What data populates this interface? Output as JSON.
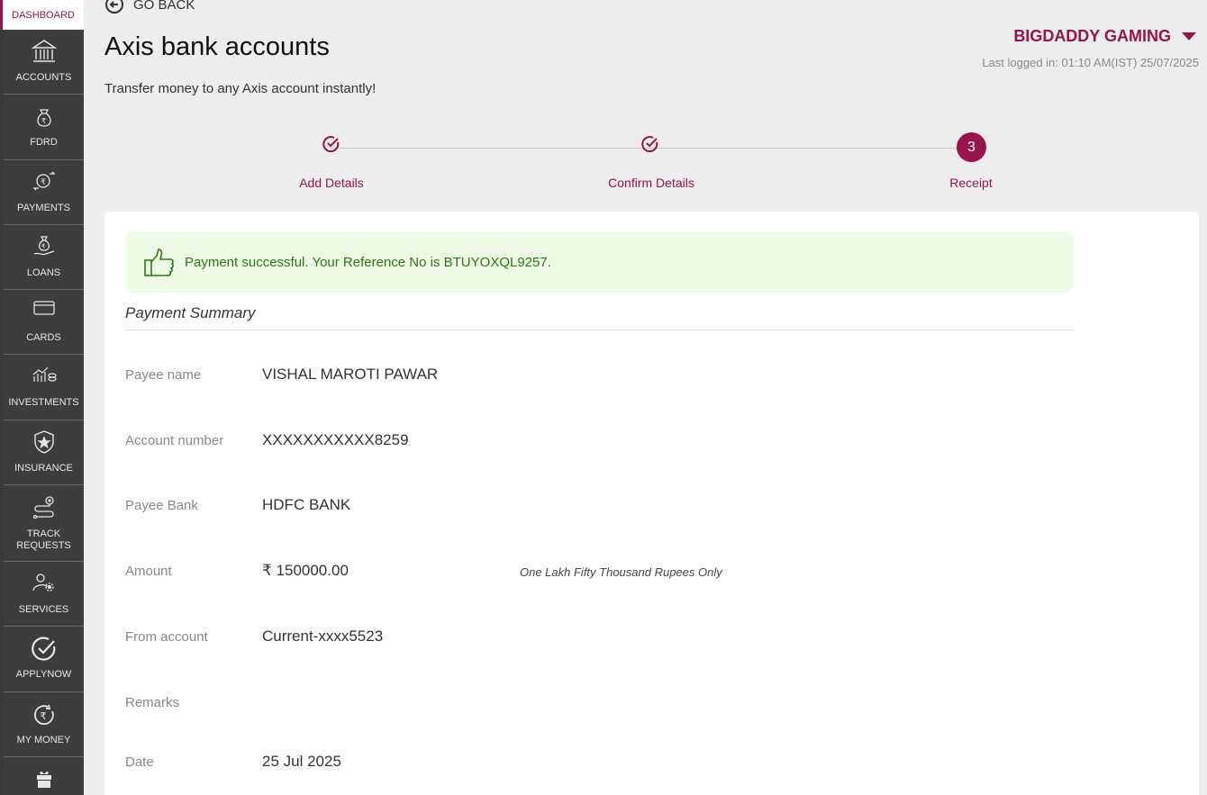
{
  "sidebar": {
    "dashboard": "DASHBOARD",
    "items": [
      {
        "label": "ACCOUNTS",
        "icon": "bank-icon"
      },
      {
        "label": "FDRD",
        "icon": "money-bag-icon"
      },
      {
        "label": "PAYMENTS",
        "icon": "payments-icon"
      },
      {
        "label": "LOANS",
        "icon": "loan-icon"
      },
      {
        "label": "CARDS",
        "icon": "card-icon"
      },
      {
        "label": "INVESTMENTS",
        "icon": "investment-chart-icon"
      },
      {
        "label": "INSURANCE",
        "icon": "shield-star-icon"
      },
      {
        "label": "TRACK REQUESTS",
        "icon": "track-route-icon"
      },
      {
        "label": "SERVICES",
        "icon": "services-gear-icon"
      },
      {
        "label": "APPLYNOW",
        "icon": "check-circle-icon"
      },
      {
        "label": "MY MONEY",
        "icon": "rupee-circle-icon"
      }
    ]
  },
  "header": {
    "go_back": "GO BACK",
    "title": "Axis bank accounts",
    "subtitle": "Transfer money to any Axis account instantly!",
    "user_name": "BIGDADDY GAMING",
    "last_logged": "Last logged in: 01:10 AM(IST) 25/07/2025"
  },
  "stepper": {
    "steps": [
      {
        "label": "Add Details",
        "status": "done"
      },
      {
        "label": "Confirm Details",
        "status": "done"
      },
      {
        "label": "Receipt",
        "status": "current",
        "number": "3"
      }
    ]
  },
  "receipt": {
    "success_message": "Payment successful. Your Reference No is BTUYOXQL9257.",
    "summary_title": "Payment Summary",
    "rows": [
      {
        "label": "Payee name",
        "value": "VISHAL MAROTI PAWAR"
      },
      {
        "label": "Account number",
        "value": "XXXXXXXXXXX8259"
      },
      {
        "label": "Payee Bank",
        "value": "HDFC BANK"
      },
      {
        "label": "Amount",
        "value": "₹ 150000.00",
        "extra": "One Lakh Fifty Thousand Rupees Only"
      },
      {
        "label": "From account",
        "value": "Current-xxxx5523"
      },
      {
        "label": "Remarks",
        "value": ""
      },
      {
        "label": "Date",
        "value": "25 Jul 2025"
      }
    ]
  },
  "colors": {
    "brand": "#97144d",
    "success_bg": "#eef9e6",
    "success_text": "#2a7a10",
    "sidebar_bg": "#3d3d3d"
  }
}
